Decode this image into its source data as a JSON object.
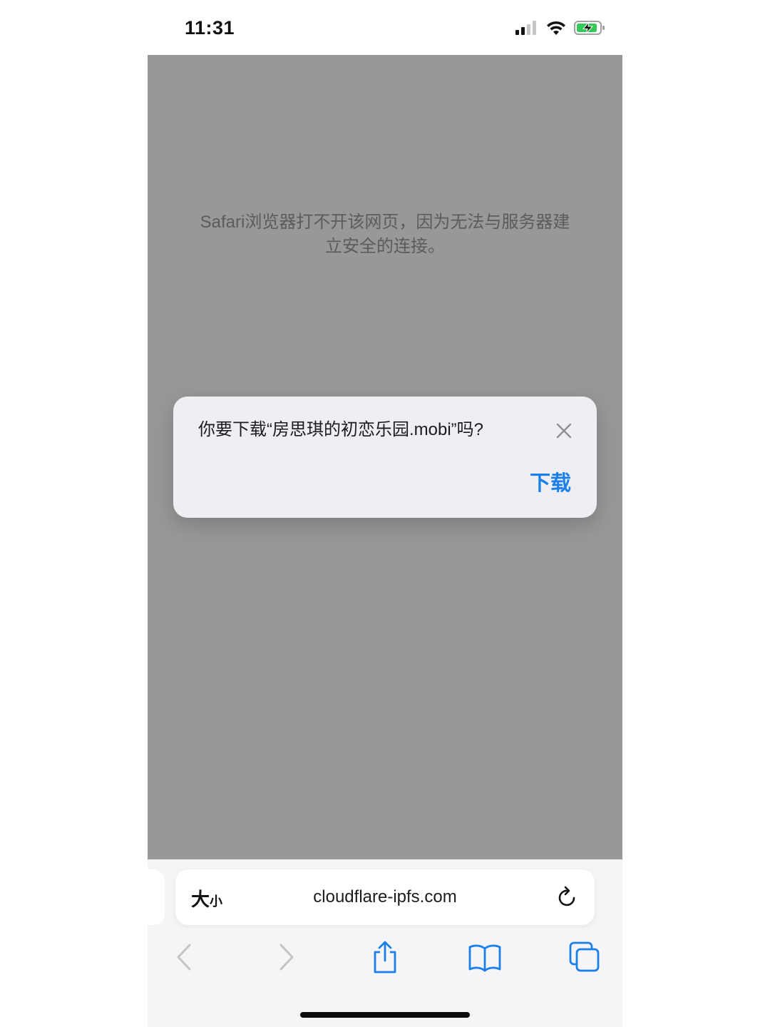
{
  "status_bar": {
    "time": "11:31"
  },
  "web_page": {
    "error_message": "Safari浏览器打不开该网页，因为无法与服务器建立安全的连接。"
  },
  "download_dialog": {
    "question": "你要下载“房思琪的初恋乐园.mobi”吗?",
    "download_label": "下载",
    "accent_color": "#1a7fe8"
  },
  "address_bar": {
    "font_size_label_big": "大",
    "font_size_label_small": "小",
    "url": "cloudflare-ipfs.com"
  },
  "toolbar": {
    "icons": [
      "back-icon",
      "forward-icon",
      "share-icon",
      "bookmarks-icon",
      "tabs-icon"
    ],
    "accent_color": "#1a7fe8"
  }
}
